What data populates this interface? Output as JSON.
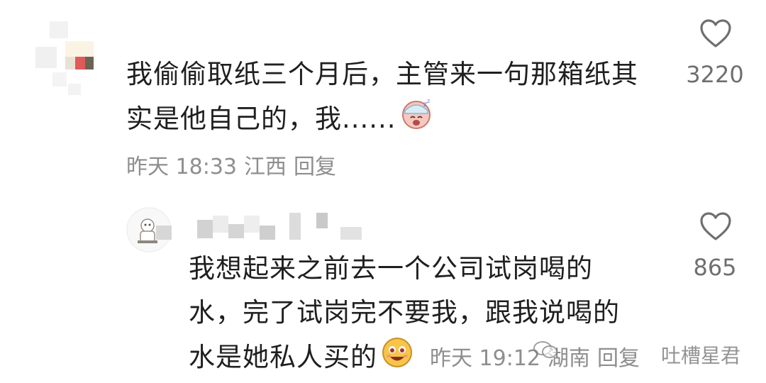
{
  "comments": [
    {
      "text_lines": [
        "我偷偷取纸三个月后，主管来一句那箱纸其",
        "实是他自己的，我......"
      ],
      "emoji": "sleepy-face-emoji",
      "time": "昨天 18:33",
      "location": "江西",
      "reply_label": "回复",
      "likes": "3220"
    },
    {
      "text_lines": [
        "我想起来之前去一个公司试岗喝的",
        "水，完了试岗完不要我，跟我说喝的",
        "水是她私人买的"
      ],
      "emoji": "grinning-face-emoji",
      "time": "昨天 19:12",
      "location": "湖南",
      "reply_label": "回复",
      "likes": "865"
    }
  ],
  "watermark": "吐槽星君",
  "colors": {
    "text": "#1f1f1f",
    "meta": "#8e8e8e",
    "heart": "#6f6f6f"
  }
}
